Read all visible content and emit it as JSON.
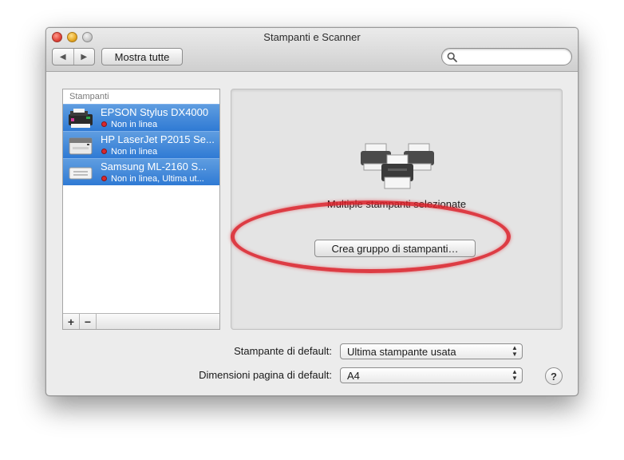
{
  "window": {
    "title": "Stampanti e Scanner"
  },
  "toolbar": {
    "back_icon": "back-arrow-icon",
    "forward_icon": "forward-arrow-icon",
    "show_all_label": "Mostra tutte",
    "search_placeholder": "",
    "search_value": ""
  },
  "printers": {
    "header": "Stampanti",
    "items": [
      {
        "name": "EPSON Stylus DX4000",
        "status": "Non in linea",
        "icon": "inkjet-printer-icon"
      },
      {
        "name": "HP LaserJet P2015 Se...",
        "status": "Non in linea",
        "icon": "laser-printer-icon"
      },
      {
        "name": "Samsung ML-2160 S...",
        "status": "Non in linea, Ultima ut...",
        "icon": "laser-printer-icon"
      }
    ],
    "add_label": "+",
    "remove_label": "−"
  },
  "detail": {
    "selection_label": "Multiple stampanti selezionate",
    "create_group_label": "Crea gruppo di stampanti…",
    "icon": "multiple-printers-icon"
  },
  "settings": {
    "default_printer_label": "Stampante di default:",
    "default_printer_value": "Ultima stampante usata",
    "default_paper_label": "Dimensioni pagina di default:",
    "default_paper_value": "A4"
  },
  "help_label": "?",
  "colors": {
    "selection": "#3a82d8",
    "offline_dot": "#d8282e",
    "annotation": "#dc1e28"
  }
}
